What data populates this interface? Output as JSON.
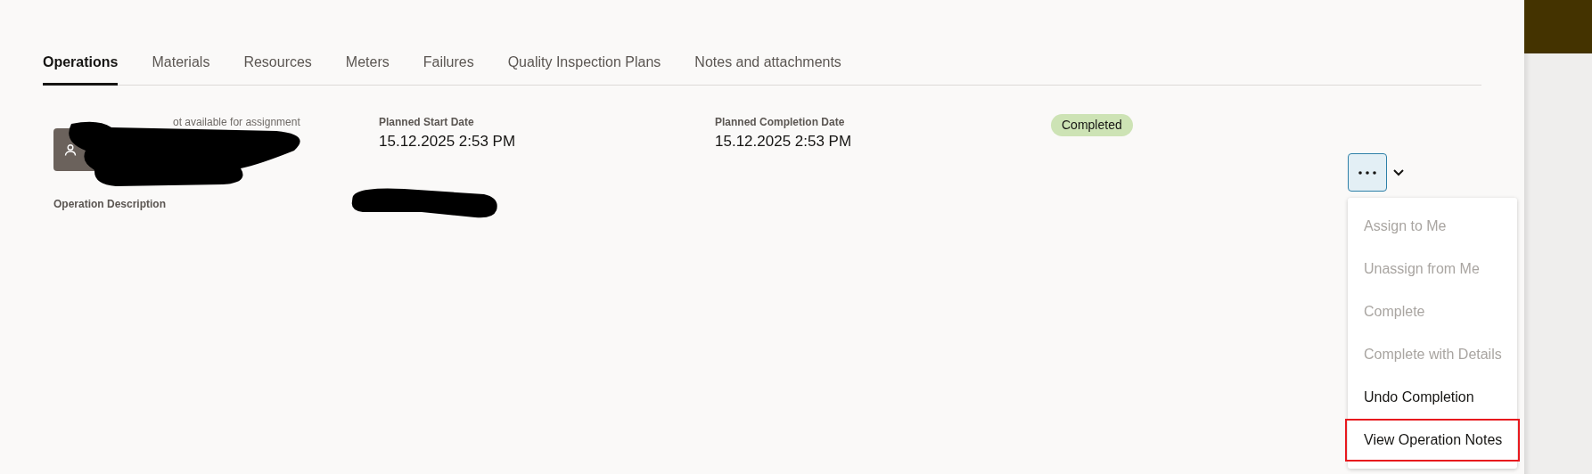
{
  "tabs": [
    {
      "label": "Operations",
      "selected": true
    },
    {
      "label": "Materials",
      "selected": false
    },
    {
      "label": "Resources",
      "selected": false
    },
    {
      "label": "Meters",
      "selected": false
    },
    {
      "label": "Failures",
      "selected": false
    },
    {
      "label": "Quality Inspection Plans",
      "selected": false
    },
    {
      "label": "Notes and attachments",
      "selected": false
    }
  ],
  "operation": {
    "assignment_note": "ot available for assignment",
    "description_label": "Operation Description",
    "fields": [
      {
        "label": "Planned Start Date",
        "value": "15.12.2025 2:53 PM"
      },
      {
        "label": "Planned Completion Date",
        "value": "15.12.2025 2:53 PM"
      }
    ],
    "status": "Completed"
  },
  "menu": {
    "open": true,
    "items": [
      {
        "label": "Assign to Me",
        "disabled": true,
        "highlighted": false
      },
      {
        "label": "Unassign from Me",
        "disabled": true,
        "highlighted": false
      },
      {
        "label": "Complete",
        "disabled": true,
        "highlighted": false
      },
      {
        "label": "Complete with Details",
        "disabled": true,
        "highlighted": false
      },
      {
        "label": "Undo Completion",
        "disabled": false,
        "highlighted": false
      },
      {
        "label": "View Operation Notes",
        "disabled": false,
        "highlighted": true
      }
    ]
  }
}
